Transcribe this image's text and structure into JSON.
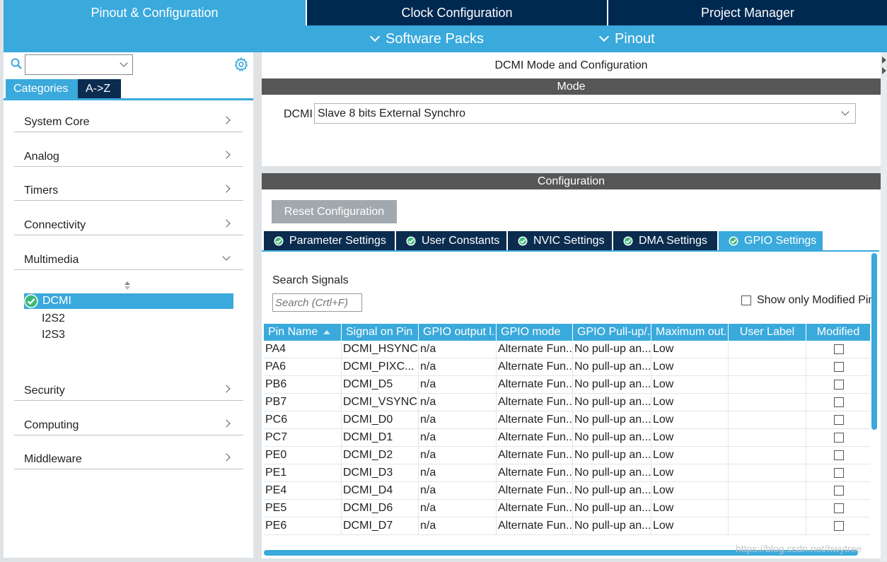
{
  "top_tabs": [
    {
      "label": "Pinout & Configuration"
    },
    {
      "label": "Clock Configuration"
    },
    {
      "label": "Project Manager"
    }
  ],
  "sub_menu": {
    "software_packs": "Software Packs",
    "pinout": "Pinout"
  },
  "left": {
    "tabs": {
      "categories": "Categories",
      "az": "A->Z"
    },
    "categories": {
      "system_core": "System Core",
      "analog": "Analog",
      "timers": "Timers",
      "connectivity": "Connectivity",
      "multimedia": "Multimedia",
      "security": "Security",
      "computing": "Computing",
      "middleware": "Middleware"
    },
    "multimedia_items": [
      "DCMI",
      "I2S2",
      "I2S3"
    ]
  },
  "mode_panel": {
    "title": "DCMI Mode and Configuration",
    "mode_header": "Mode",
    "dcmi_label": "DCMI",
    "dcmi_value": "Slave 8 bits External Synchro"
  },
  "config_panel": {
    "header": "Configuration",
    "reset_label": "Reset Configuration",
    "tabs": [
      "Parameter Settings",
      "User Constants",
      "NVIC Settings",
      "DMA Settings",
      "GPIO Settings"
    ],
    "search_label": "Search Signals",
    "search_placeholder": "Search (Crtl+F)",
    "show_modified": "Show only Modified Pin",
    "columns": [
      "Pin Name",
      "Signal on Pin",
      "GPIO output l...",
      "GPIO mode",
      "GPIO Pull-up/...",
      "Maximum out...",
      "User Label",
      "Modified"
    ],
    "rows": [
      [
        "PA4",
        "DCMI_HSYNC",
        "n/a",
        "Alternate Fun...",
        "No pull-up an...",
        "Low",
        ""
      ],
      [
        "PA6",
        "DCMI_PIXC...",
        "n/a",
        "Alternate Fun...",
        "No pull-up an...",
        "Low",
        ""
      ],
      [
        "PB6",
        "DCMI_D5",
        "n/a",
        "Alternate Fun...",
        "No pull-up an...",
        "Low",
        ""
      ],
      [
        "PB7",
        "DCMI_VSYNC",
        "n/a",
        "Alternate Fun...",
        "No pull-up an...",
        "Low",
        ""
      ],
      [
        "PC6",
        "DCMI_D0",
        "n/a",
        "Alternate Fun...",
        "No pull-up an...",
        "Low",
        ""
      ],
      [
        "PC7",
        "DCMI_D1",
        "n/a",
        "Alternate Fun...",
        "No pull-up an...",
        "Low",
        ""
      ],
      [
        "PE0",
        "DCMI_D2",
        "n/a",
        "Alternate Fun...",
        "No pull-up an...",
        "Low",
        ""
      ],
      [
        "PE1",
        "DCMI_D3",
        "n/a",
        "Alternate Fun...",
        "No pull-up an...",
        "Low",
        ""
      ],
      [
        "PE4",
        "DCMI_D4",
        "n/a",
        "Alternate Fun...",
        "No pull-up an...",
        "Low",
        ""
      ],
      [
        "PE5",
        "DCMI_D6",
        "n/a",
        "Alternate Fun...",
        "No pull-up an...",
        "Low",
        ""
      ],
      [
        "PE6",
        "DCMI_D7",
        "n/a",
        "Alternate Fun...",
        "No pull-up an...",
        "Low",
        ""
      ]
    ]
  },
  "watermark": "https://blog.csdn.net/hwytree",
  "colors": {
    "accent": "#3aa9dc",
    "navy": "#002952",
    "section_bar": "#575757",
    "check_green": "#3cb878"
  }
}
